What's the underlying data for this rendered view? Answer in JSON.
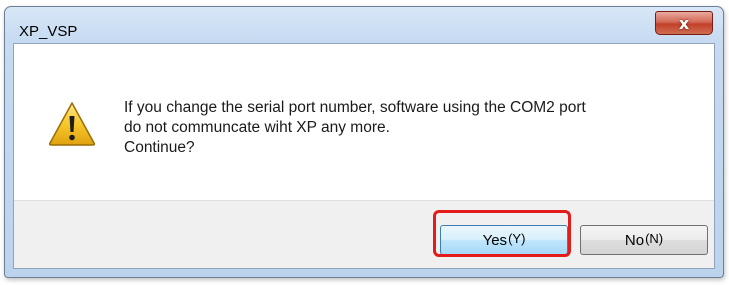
{
  "window": {
    "title": "XP_VSP",
    "close_glyph": "x"
  },
  "dialog": {
    "icon": "warning-icon",
    "message_lines": [
      "If you change the serial port number, software using the COM2 port",
      "do not communcate wiht XP any more.",
      "Continue?"
    ]
  },
  "buttons": {
    "yes": {
      "label": "Yes",
      "accel": "(Y)"
    },
    "no": {
      "label": "No",
      "accel": "(N)"
    }
  },
  "colors": {
    "highlight": "#e31b1b",
    "warning_fill": "#f6c72b",
    "close_button": "#c2402a"
  }
}
